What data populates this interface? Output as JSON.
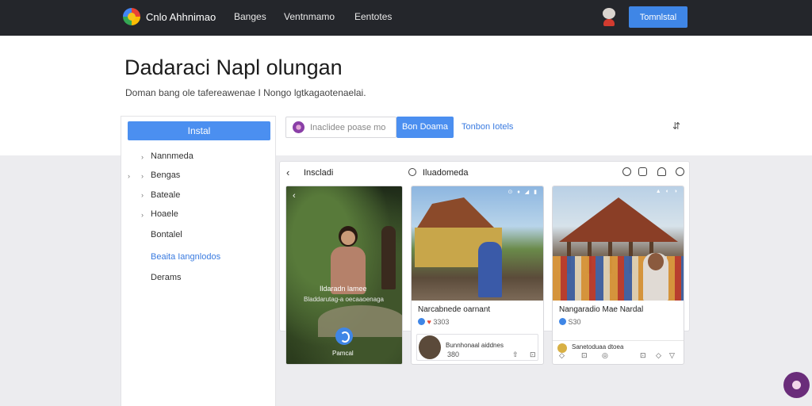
{
  "topnav": {
    "brand": "Cnlo Ahhnimao",
    "links": [
      "Banges",
      "Ventnmamo",
      "Eentotes"
    ],
    "cta": "Tomnlstal"
  },
  "header": {
    "title": "Dadaraci Napl olungan",
    "subtitle": "Doman bang ole tafereawenae I Nongo lgtkagaotenaelai."
  },
  "sidebar": {
    "button": "Instal",
    "items": [
      {
        "label": "Nannmeda",
        "chevron": "›"
      },
      {
        "label": "Bengas",
        "chevron": "›"
      },
      {
        "label": "Bateale",
        "chevron": "›"
      },
      {
        "label": "Hoaele",
        "chevron": "›"
      },
      {
        "label": "Bontalel",
        "chevron": ""
      },
      {
        "label": "Beaita Iangnlodos",
        "chevron": ""
      },
      {
        "label": "Derams",
        "chevron": ""
      }
    ],
    "extra_chevron": "›"
  },
  "search": {
    "text": "Inaclidee poase mo",
    "button": "Bon Doama",
    "link": "Tonbon Iotels",
    "sort_icon": "sort-icon"
  },
  "feed": {
    "back": "‹",
    "title": "Inscladi",
    "sub": "Iluadomeda"
  },
  "cards": {
    "dark": {
      "back": "‹",
      "caption1": "Ildaradn lamee",
      "caption2": "Bladdarutag-a oecaaoenaga",
      "fab_label": "Pamcal"
    },
    "b": {
      "status": "⊙ ♦ ◢ ▮",
      "name": "Narcabnede oarnant",
      "reactions": "3303",
      "comment_name": "Bunnhonaal aiddnes",
      "comment_meta": "380",
      "actions": [
        "⇧",
        "⊡"
      ]
    },
    "c": {
      "status": "▲ ◐ ◑",
      "name": "Nangaradio Mae Nardal",
      "reactions": "S30",
      "footer_name": "Sanetoduaa dtoea",
      "footer_actions": [
        "◇",
        "⊡",
        "◎",
        "⊡",
        "◇",
        "▽"
      ]
    }
  },
  "colors": {
    "nav_bg": "#24262b",
    "accent": "#3f86e6",
    "fab": "#6a2d7a"
  }
}
